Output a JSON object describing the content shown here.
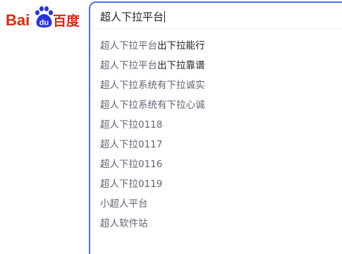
{
  "logo": {
    "text_left": "Bai",
    "text_du": "du",
    "text_right": "百度",
    "brand_red": "#de2910",
    "brand_blue": "#2932e1"
  },
  "search": {
    "value": "超人下拉平台",
    "border_color": "#4e6ef2"
  },
  "suggestions": [
    {
      "prefix": "超人下拉平台",
      "rest": "出下拉能行"
    },
    {
      "prefix": "超人下拉平台",
      "rest": "出下拉靠谱"
    },
    {
      "prefix": "超人下拉系统有下拉诚实",
      "rest": ""
    },
    {
      "prefix": "超人下拉系统有下拉心诚",
      "rest": ""
    },
    {
      "prefix": "超人下拉0118",
      "rest": ""
    },
    {
      "prefix": "超人下拉0117",
      "rest": ""
    },
    {
      "prefix": "超人下拉0116",
      "rest": ""
    },
    {
      "prefix": "超人下拉0119",
      "rest": ""
    },
    {
      "prefix": "小超人平台",
      "rest": ""
    },
    {
      "prefix": "超人软件站",
      "rest": ""
    }
  ]
}
